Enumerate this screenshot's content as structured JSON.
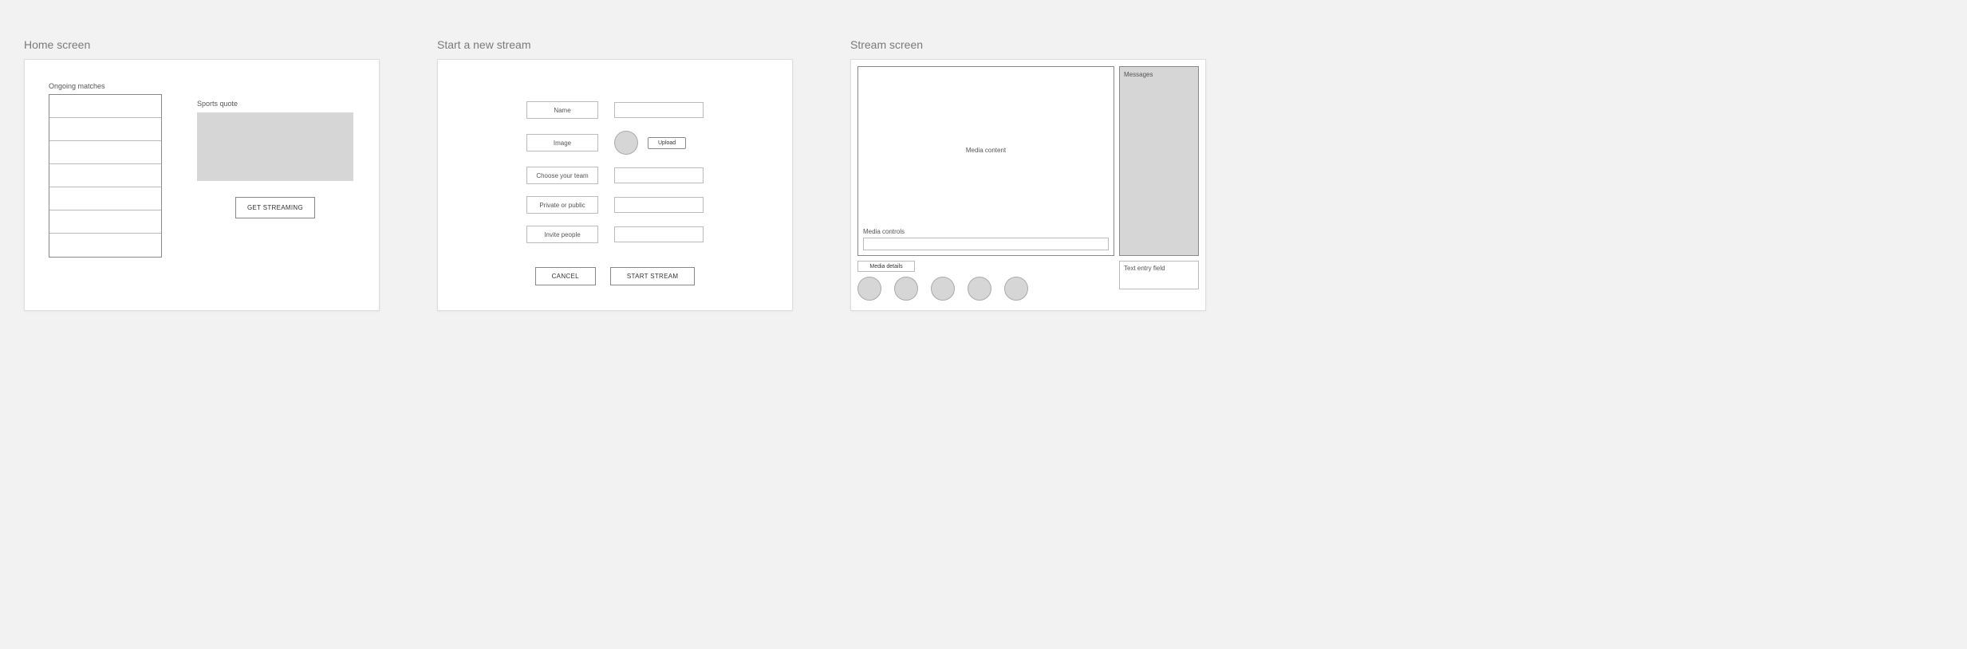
{
  "screens": {
    "home": {
      "title": "Home screen",
      "ongoing_label": "Ongoing matches",
      "quote_label": "Sports quote",
      "get_streaming_label": "GET STREAMING",
      "match_rows": [
        "",
        "",
        "",
        "",
        "",
        "",
        ""
      ]
    },
    "start": {
      "title": "Start a new stream",
      "labels": {
        "name": "Name",
        "image": "Image",
        "team": "Choose your team",
        "privacy": "Private or public",
        "invite": "Invite people"
      },
      "upload_label": "Upload",
      "cancel_label": "CANCEL",
      "start_label": "START STREAM"
    },
    "stream": {
      "title": "Stream screen",
      "media_content_label": "Media content",
      "media_controls_label": "Media controls",
      "messages_label": "Messages",
      "media_details_label": "Media details",
      "text_entry_label": "Text entry field",
      "avatars": [
        "",
        "",
        "",
        "",
        ""
      ]
    }
  }
}
